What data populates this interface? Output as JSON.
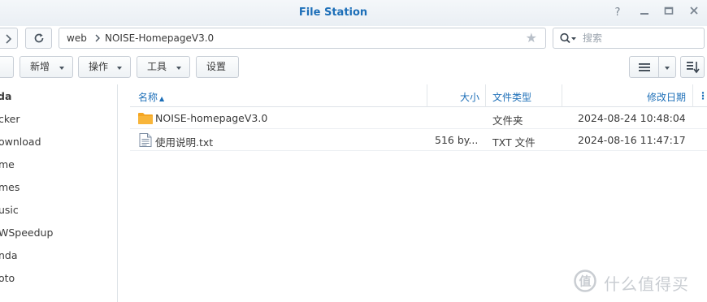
{
  "window": {
    "title": "File Station",
    "help_icon": "?",
    "min_icon": "minimize",
    "max_icon": "maximize",
    "close_icon": "close"
  },
  "nav": {
    "breadcrumb": [
      "web",
      "NOISE-HomepageV3.0"
    ],
    "search_placeholder": "搜索"
  },
  "toolbar": {
    "create_label": "新增",
    "action_label": "操作",
    "tools_label": "工具",
    "settings_label": "设置"
  },
  "sidebar": {
    "items": [
      "da",
      "cker",
      "ownload",
      "me",
      "mes",
      "usic",
      "WSpeedup",
      "nda",
      "oto"
    ]
  },
  "table": {
    "columns": {
      "name": "名称",
      "size": "大小",
      "type": "文件类型",
      "modified": "修改日期"
    },
    "sort_indicator": "▲",
    "rows": [
      {
        "name": "NOISE-homepageV3.0",
        "size": "",
        "type": "文件夹",
        "modified": "2024-08-24 10:48:04",
        "icon": "folder-icon"
      },
      {
        "name": "使用说明.txt",
        "size": "516 by...",
        "type": "TXT 文件",
        "modified": "2024-08-16 11:47:17",
        "icon": "text-file-icon"
      }
    ]
  },
  "watermark": {
    "text": "什么值得买"
  },
  "colors": {
    "accent": "#1d6fb8",
    "folder": "#f5a623",
    "border": "#c8ced6"
  }
}
